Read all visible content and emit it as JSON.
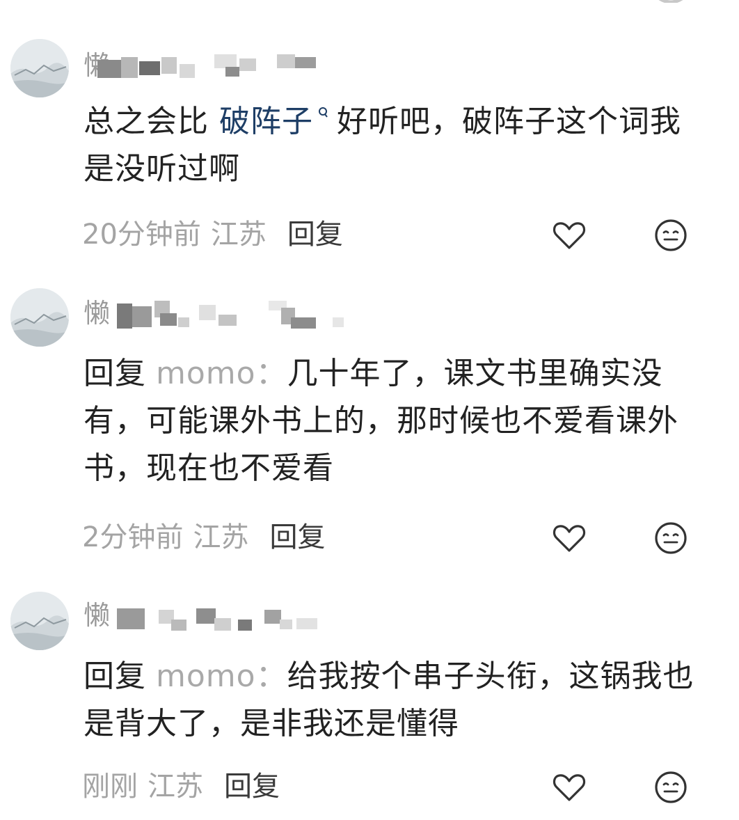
{
  "colors": {
    "text_primary": "#222222",
    "text_meta": "#a4a4a4",
    "link": "#1e3e66",
    "mention": "#a9a9a9"
  },
  "comments": [
    {
      "username_visible": "懒",
      "content_prefix": "总之会比 ",
      "content_link": "破阵子",
      "content_suffix": "好听吧，破阵子这个词我是没听过啊",
      "time": "20分钟前",
      "location": "江苏",
      "reply_label": "回复",
      "like_icon": "heart-outline-icon",
      "dislike_icon": "meh-face-icon"
    },
    {
      "username_visible": "懒",
      "reply_prefix": "回复",
      "mention": "momo：",
      "content": "几十年了，课文书里确实没有，可能课外书上的，那时候也不爱看课外书，现在也不爱看",
      "time": "2分钟前",
      "location": "江苏",
      "reply_label": "回复",
      "like_icon": "heart-outline-icon",
      "dislike_icon": "meh-face-icon"
    },
    {
      "username_visible": "懒",
      "reply_prefix": "回复",
      "mention": "momo：",
      "content": "给我按个串子头衔，这锅我也是背大了，是非我还是懂得",
      "time": "刚刚",
      "location": "江苏",
      "reply_label": "回复",
      "like_icon": "heart-outline-icon",
      "dislike_icon": "meh-face-icon"
    }
  ]
}
